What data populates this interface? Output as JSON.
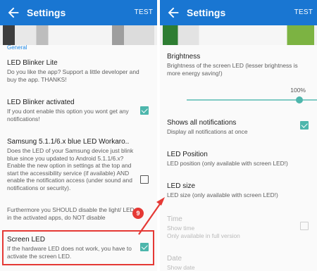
{
  "left": {
    "appbar": {
      "title": "Settings",
      "action": "TEST"
    },
    "section_header": "General",
    "items": [
      {
        "title": "LED Blinker Lite",
        "summary": "Do you like the app? Support a little developer and buy the app. THANKS!"
      },
      {
        "title": "LED Blinker activated",
        "summary": "If you dont enable this option you wont get any notifications!",
        "checked": true
      },
      {
        "title": "Samsung 5.1.1/6.x blue LED Workaro..",
        "summary": "Does the LED of your Samsung device just blink blue since you updated to Android 5.1.1/6.x? Enable the new option in settings at the top and start the accessibility service (if available) AND enable the notification access (under sound and notifications or security).",
        "checked": false
      },
      {
        "title": "",
        "summary": "Furthermore you SHOULD disable the light/ LED in the activated apps, do NOT disable"
      },
      {
        "title": "Screen LED",
        "summary": "If the hardware LED does not work, you have to activate the screen LED.",
        "checked": true
      }
    ]
  },
  "right": {
    "appbar": {
      "title": "Settings",
      "action": "TEST"
    },
    "items": [
      {
        "title": "Brightness",
        "summary": "Brightness of the screen LED (lesser brightness is more energy saving!)"
      },
      {
        "title": "Shows all notifications",
        "summary": "Display all notifications at once",
        "checked": true
      },
      {
        "title": "LED Position",
        "summary": "LED position (only available with screen LED!)"
      },
      {
        "title": "LED size",
        "summary": "LED size (only available with screen LED!)"
      },
      {
        "title": "Time",
        "summary": "Show time\nOnly available in full version",
        "checked": false,
        "disabled": true
      },
      {
        "title": "Date",
        "summary": "Show date",
        "disabled": true
      }
    ],
    "brightness": {
      "value_label": "100%",
      "level": 1.0
    }
  },
  "annotation": {
    "step_number": "9"
  },
  "colors": {
    "appbar": "#1976d2",
    "accent": "#4db6ac",
    "highlight": "#e53935"
  }
}
